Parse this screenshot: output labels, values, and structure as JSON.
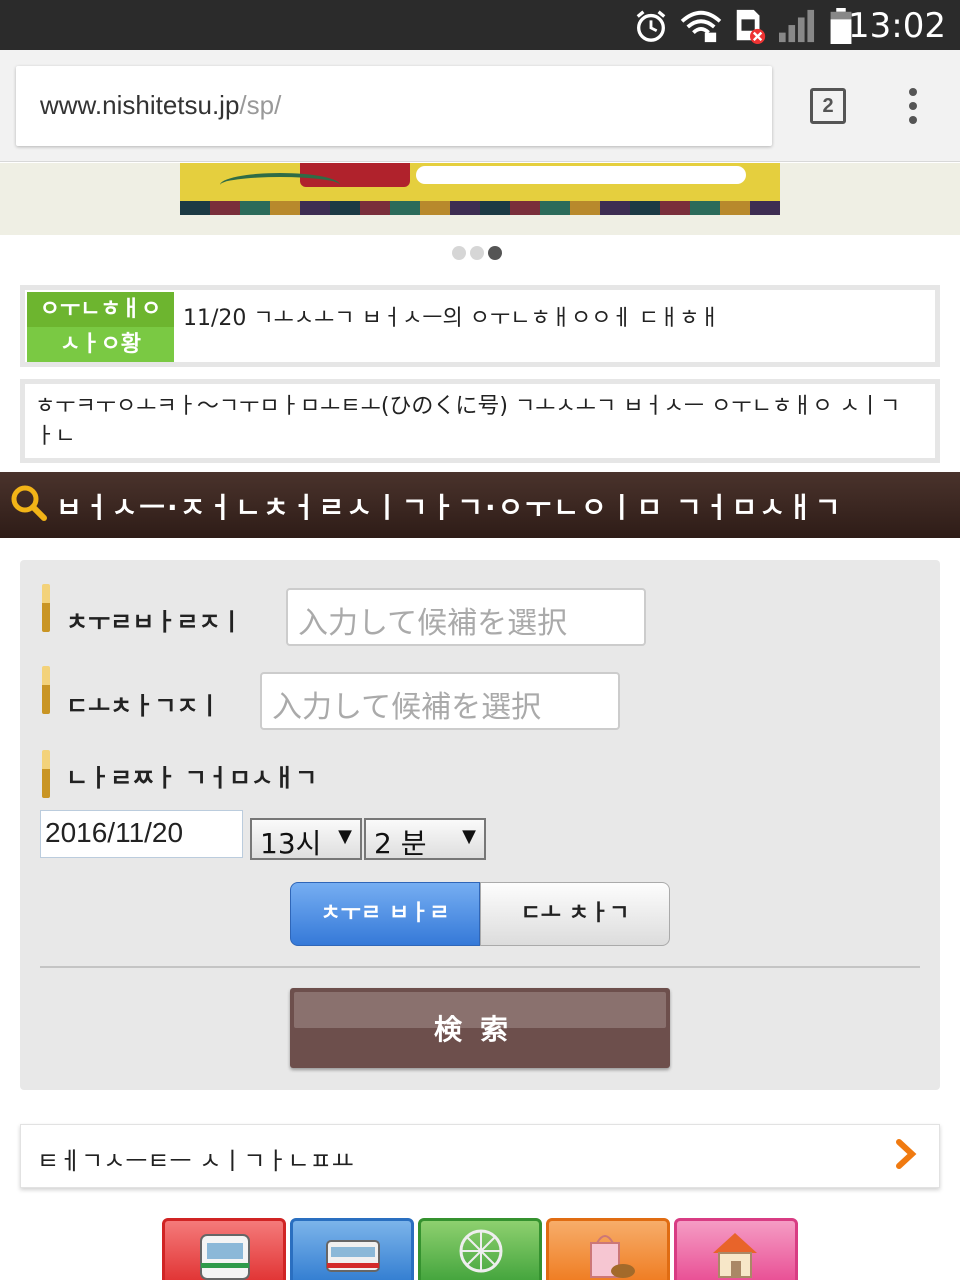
{
  "status_bar": {
    "time": "13:02",
    "icons": [
      "alarm-icon",
      "wifi-icon",
      "sim-error-icon",
      "signal-icon",
      "battery-icon"
    ]
  },
  "browser": {
    "url_host": "www.nishitetsu.jp",
    "url_path": "/sp/",
    "tab_count": "2"
  },
  "carousel": {
    "slide_count": 3,
    "active_index": 2
  },
  "notices": [
    {
      "badge_line1": "ㅇㅜㄴㅎㅐㅇ",
      "badge_line2": "ㅅㅏㅇ황",
      "text": "11/20 ㄱㅗㅅㅗㄱ ㅂㅓㅅㅡ의 ㅇㅜㄴㅎㅐㅇㅇㅔ ㄷㅐㅎㅐ"
    },
    {
      "text": "ㅎㅜㅋㅜㅇㅗㅋㅏ～ㄱㅜㅁㅏㅁㅗㅌㅗ(ひのくに号) ㄱㅗㅅㅗㄱ ㅂㅓㅅㅡ ㅇㅜㄴㅎㅐㅇ ㅅㅣㄱㅏㄴ"
    }
  ],
  "section": {
    "title": "ㅂㅓㅅㅡ·ㅈㅓㄴㅊㅓㄹㅅㅣㄱㅏㄱ·ㅇㅜㄴㅇㅣㅁ ㄱㅓㅁㅅㅐㄱ"
  },
  "form": {
    "departure_label": "ㅊㅜㄹㅂㅏㄹㅈㅣ",
    "departure_placeholder": "入力して候補を選択",
    "arrival_label": "ㄷㅗㅊㅏㄱㅈㅣ",
    "arrival_placeholder": "入力して候補を選択",
    "datetime_label": "ㄴㅏㄹㅉㅏ ㄱㅓㅁㅅㅐㄱ",
    "date_value": "2016/11/20",
    "hour_value": "13시",
    "minute_value": "2 분",
    "toggle_depart": "ㅊㅜㄹ ㅂㅏㄹ",
    "toggle_arrive": "ㄷㅗ ㅊㅏㄱ",
    "toggle_selected": "depart",
    "search_label": "検索"
  },
  "links": {
    "ticket_price": "ㅌㅔㄱㅅㅡㅌㅡ ㅅㅣㄱㅏㄴㅍㅛ"
  },
  "categories": [
    {
      "icon": "bus-icon",
      "color": "#e03030"
    },
    {
      "icon": "train-icon",
      "color": "#2f7bd0"
    },
    {
      "icon": "ferris-wheel-icon",
      "color": "#3fa23a"
    },
    {
      "icon": "shopping-icon",
      "color": "#ef7a1e"
    },
    {
      "icon": "house-icon",
      "color": "#e84b92"
    }
  ]
}
